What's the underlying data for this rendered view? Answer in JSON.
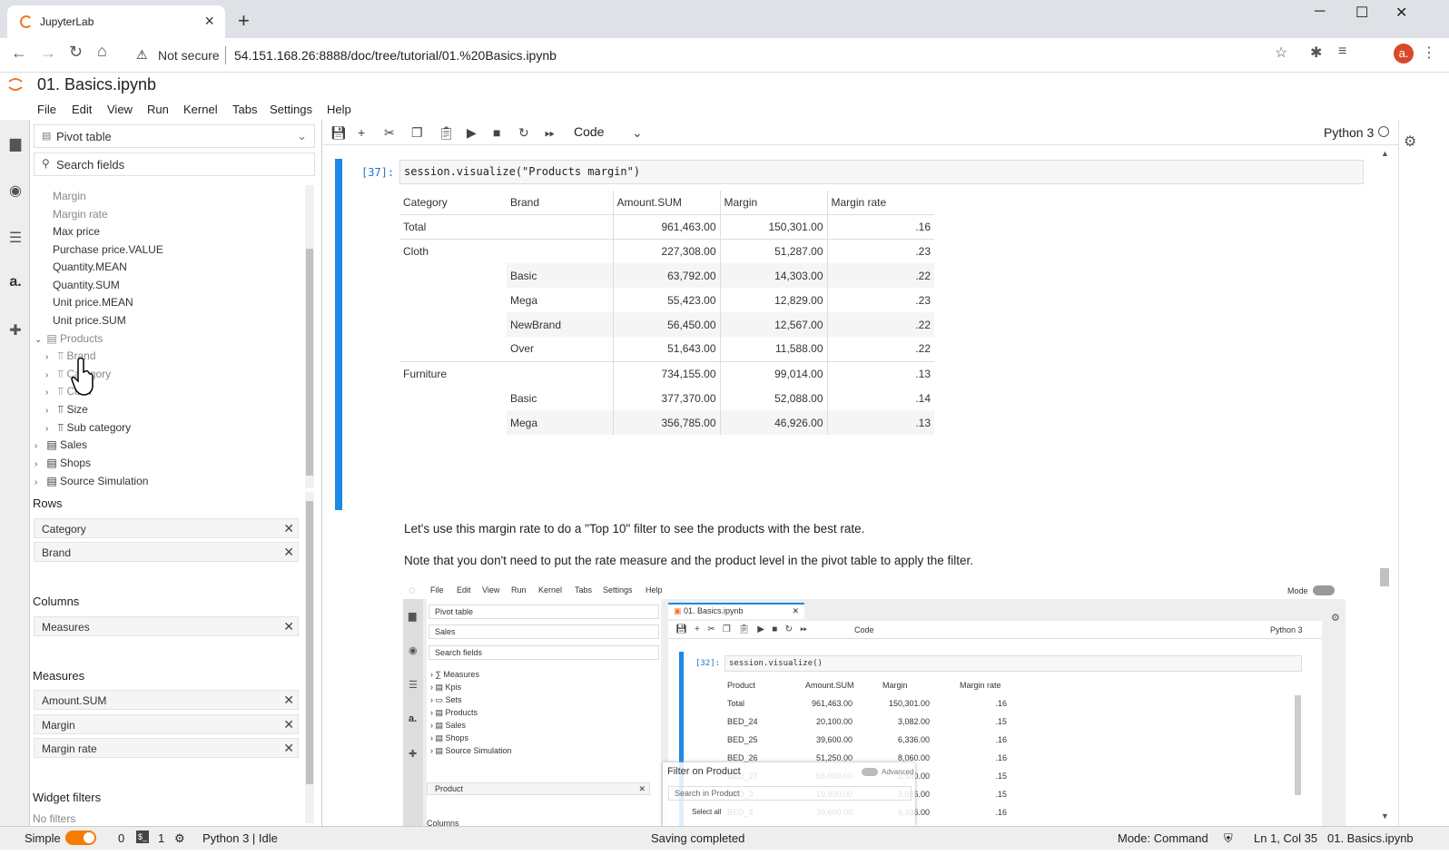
{
  "browser": {
    "tab_title": "JupyterLab",
    "not_secure": "Not secure",
    "url": "54.151.168.26:8888/doc/tree/tutorial/01.%20Basics.ipynb",
    "avatar": "a."
  },
  "notebook": {
    "title": "01. Basics.ipynb",
    "menu": [
      "File",
      "Edit",
      "View",
      "Run",
      "Kernel",
      "Tabs",
      "Settings",
      "Help"
    ],
    "cell_type": "Code",
    "kernel": "Python 3"
  },
  "sidebar": {
    "widget": "Pivot table",
    "search_placeholder": "Search fields",
    "fields": [
      "Margin",
      "Margin rate",
      "Max price",
      "Purchase price.VALUE",
      "Quantity.MEAN",
      "Quantity.SUM",
      "Unit price.MEAN",
      "Unit price.SUM"
    ],
    "products": "Products",
    "product_levels": [
      "Brand",
      "Category",
      "Color",
      "Size",
      "Sub category"
    ],
    "other_tables": [
      "Sales",
      "Shops",
      "Source Simulation"
    ],
    "rows_label": "Rows",
    "rows": [
      "Category",
      "Brand"
    ],
    "columns_label": "Columns",
    "columns": [
      "Measures"
    ],
    "measures_label": "Measures",
    "measures": [
      "Amount.SUM",
      "Margin",
      "Margin rate"
    ],
    "filters_label": "Widget filters",
    "filters_empty": "No filters"
  },
  "cell": {
    "prompt": "[37]:",
    "code": "session.visualize(\"Products margin\")"
  },
  "pivot": {
    "headers": [
      "Category",
      "Brand",
      "Amount.SUM",
      "Margin",
      "Margin rate"
    ],
    "rows": [
      {
        "c": "Total",
        "b": "",
        "a": "961,463.00",
        "m": "150,301.00",
        "r": ".16"
      },
      {
        "c": "Cloth",
        "b": "",
        "a": "227,308.00",
        "m": "51,287.00",
        "r": ".23"
      },
      {
        "c": "",
        "b": "Basic",
        "a": "63,792.00",
        "m": "14,303.00",
        "r": ".22"
      },
      {
        "c": "",
        "b": "Mega",
        "a": "55,423.00",
        "m": "12,829.00",
        "r": ".23"
      },
      {
        "c": "",
        "b": "NewBrand",
        "a": "56,450.00",
        "m": "12,567.00",
        "r": ".22"
      },
      {
        "c": "",
        "b": "Over",
        "a": "51,643.00",
        "m": "11,588.00",
        "r": ".22"
      },
      {
        "c": "Furniture",
        "b": "",
        "a": "734,155.00",
        "m": "99,014.00",
        "r": ".13"
      },
      {
        "c": "",
        "b": "Basic",
        "a": "377,370.00",
        "m": "52,088.00",
        "r": ".14"
      },
      {
        "c": "",
        "b": "Mega",
        "a": "356,785.00",
        "m": "46,926.00",
        "r": ".13"
      }
    ]
  },
  "markdown": {
    "p1": "Let's use this margin rate to do a \"Top 10\" filter to see the products with the best rate.",
    "p2": "Note that you don't need to put the rate measure and the product level in the pivot table to apply the filter."
  },
  "screenshot": {
    "menu": [
      "File",
      "Edit",
      "View",
      "Run",
      "Kernel",
      "Tabs",
      "Settings",
      "Help"
    ],
    "mode": "Mode",
    "tab": "01. Basics.ipynb",
    "widget": "Pivot table",
    "dropdown": "Sales",
    "search": "Search fields",
    "tree": [
      "Measures",
      "Kpis",
      "Sets",
      "Products",
      "Sales",
      "Shops",
      "Source Simulation"
    ],
    "cell_type": "Code",
    "kernel": "Python 3",
    "prompt": "[32]:",
    "code": "session.visualize()",
    "headers": [
      "Product",
      "Amount.SUM",
      "Margin",
      "Margin rate"
    ],
    "rows": [
      {
        "p": "Total",
        "a": "961,463.00",
        "m": "150,301.00",
        "r": ".16"
      },
      {
        "p": "BED_24",
        "a": "20,100.00",
        "m": "3,082.00",
        "r": ".15"
      },
      {
        "p": "BED_25",
        "a": "39,600.00",
        "m": "6,336.00",
        "r": ".16"
      },
      {
        "p": "BED_26",
        "a": "51,250.00",
        "m": "8,060.00",
        "r": ".16"
      },
      {
        "p": "BED_27",
        "a": "58,000.00",
        "m": "8,580.00",
        "r": ".15"
      },
      {
        "p": "BED_3",
        "a": "19,800.00",
        "m": "3,036.00",
        "r": ".15"
      },
      {
        "p": "BED_4",
        "a": "39,600.00",
        "m": "6,336.00",
        "r": ".16"
      }
    ],
    "filter_title": "Filter on Product",
    "advanced": "Advanced",
    "filter_search": "Search in Product",
    "select_all": "Select all",
    "row_pill": "Product",
    "columns": "Columns"
  },
  "status": {
    "mode_simple": "Simple",
    "terminals": "0",
    "kernels": "1",
    "kernel_status": "Python 3 | Idle",
    "saving": "Saving completed",
    "command_mode": "Mode: Command",
    "position": "Ln 1, Col 35",
    "file": "01. Basics.ipynb"
  }
}
